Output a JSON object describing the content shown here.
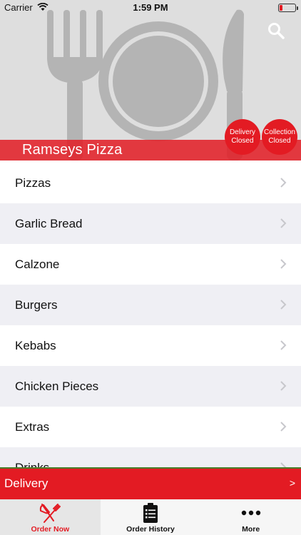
{
  "status_bar": {
    "carrier": "Carrier",
    "time": "1:59 PM",
    "battery_level": 0.2,
    "battery_color": "#e31b23"
  },
  "header": {
    "restaurant_name": "Ramseys Pizza",
    "search_icon": "search-icon",
    "delivery_status": {
      "line1": "Delivery",
      "line2": "Closed"
    },
    "collection_status": {
      "line1": "Collection",
      "line2": "Closed"
    }
  },
  "menu": {
    "categories": [
      "Pizzas",
      "Garlic Bread",
      "Calzone",
      "Burgers",
      "Kebabs",
      "Chicken Pieces",
      "Extras",
      "Drinks"
    ]
  },
  "delivery_bar": {
    "label": "Delivery",
    "arrow": ">"
  },
  "tabs": [
    {
      "label": "Order Now",
      "icon": "fork-knife-icon",
      "active": true
    },
    {
      "label": "Order History",
      "icon": "clipboard-icon",
      "active": false
    },
    {
      "label": "More",
      "icon": "more-dots-icon",
      "active": false
    }
  ],
  "colors": {
    "accent": "#e31b23",
    "hero_background": "#dedede",
    "row_alt": "#efeff4"
  }
}
